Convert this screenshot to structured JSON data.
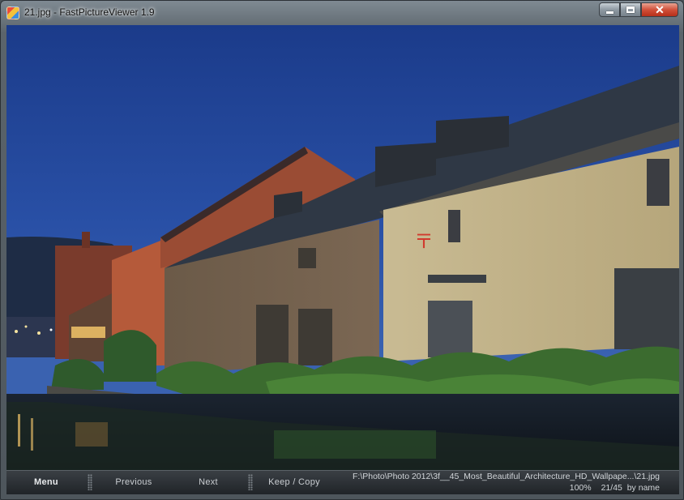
{
  "window": {
    "title": "21.jpg - FastPictureViewer 1.9",
    "app_icon": "fastpictureviewer-app-icon",
    "caption_buttons": [
      "minimize-icon",
      "maximize-icon",
      "close-icon"
    ]
  },
  "image": {
    "description_icon": "photo-canvas",
    "sky_color": "#1f3f8c",
    "accent": "#2c4fa8"
  },
  "statusbar": {
    "menu_label": "Menu",
    "previous_label": "Previous",
    "next_label": "Next",
    "keep_copy_label": "Keep / Copy",
    "file_path": "F:\\Photo\\Photo 2012\\3f__45_Most_Beautiful_Architecture_HD_Wallpape...\\21.jpg",
    "zoom": "100%",
    "position": "21/45",
    "sort": "by name"
  }
}
